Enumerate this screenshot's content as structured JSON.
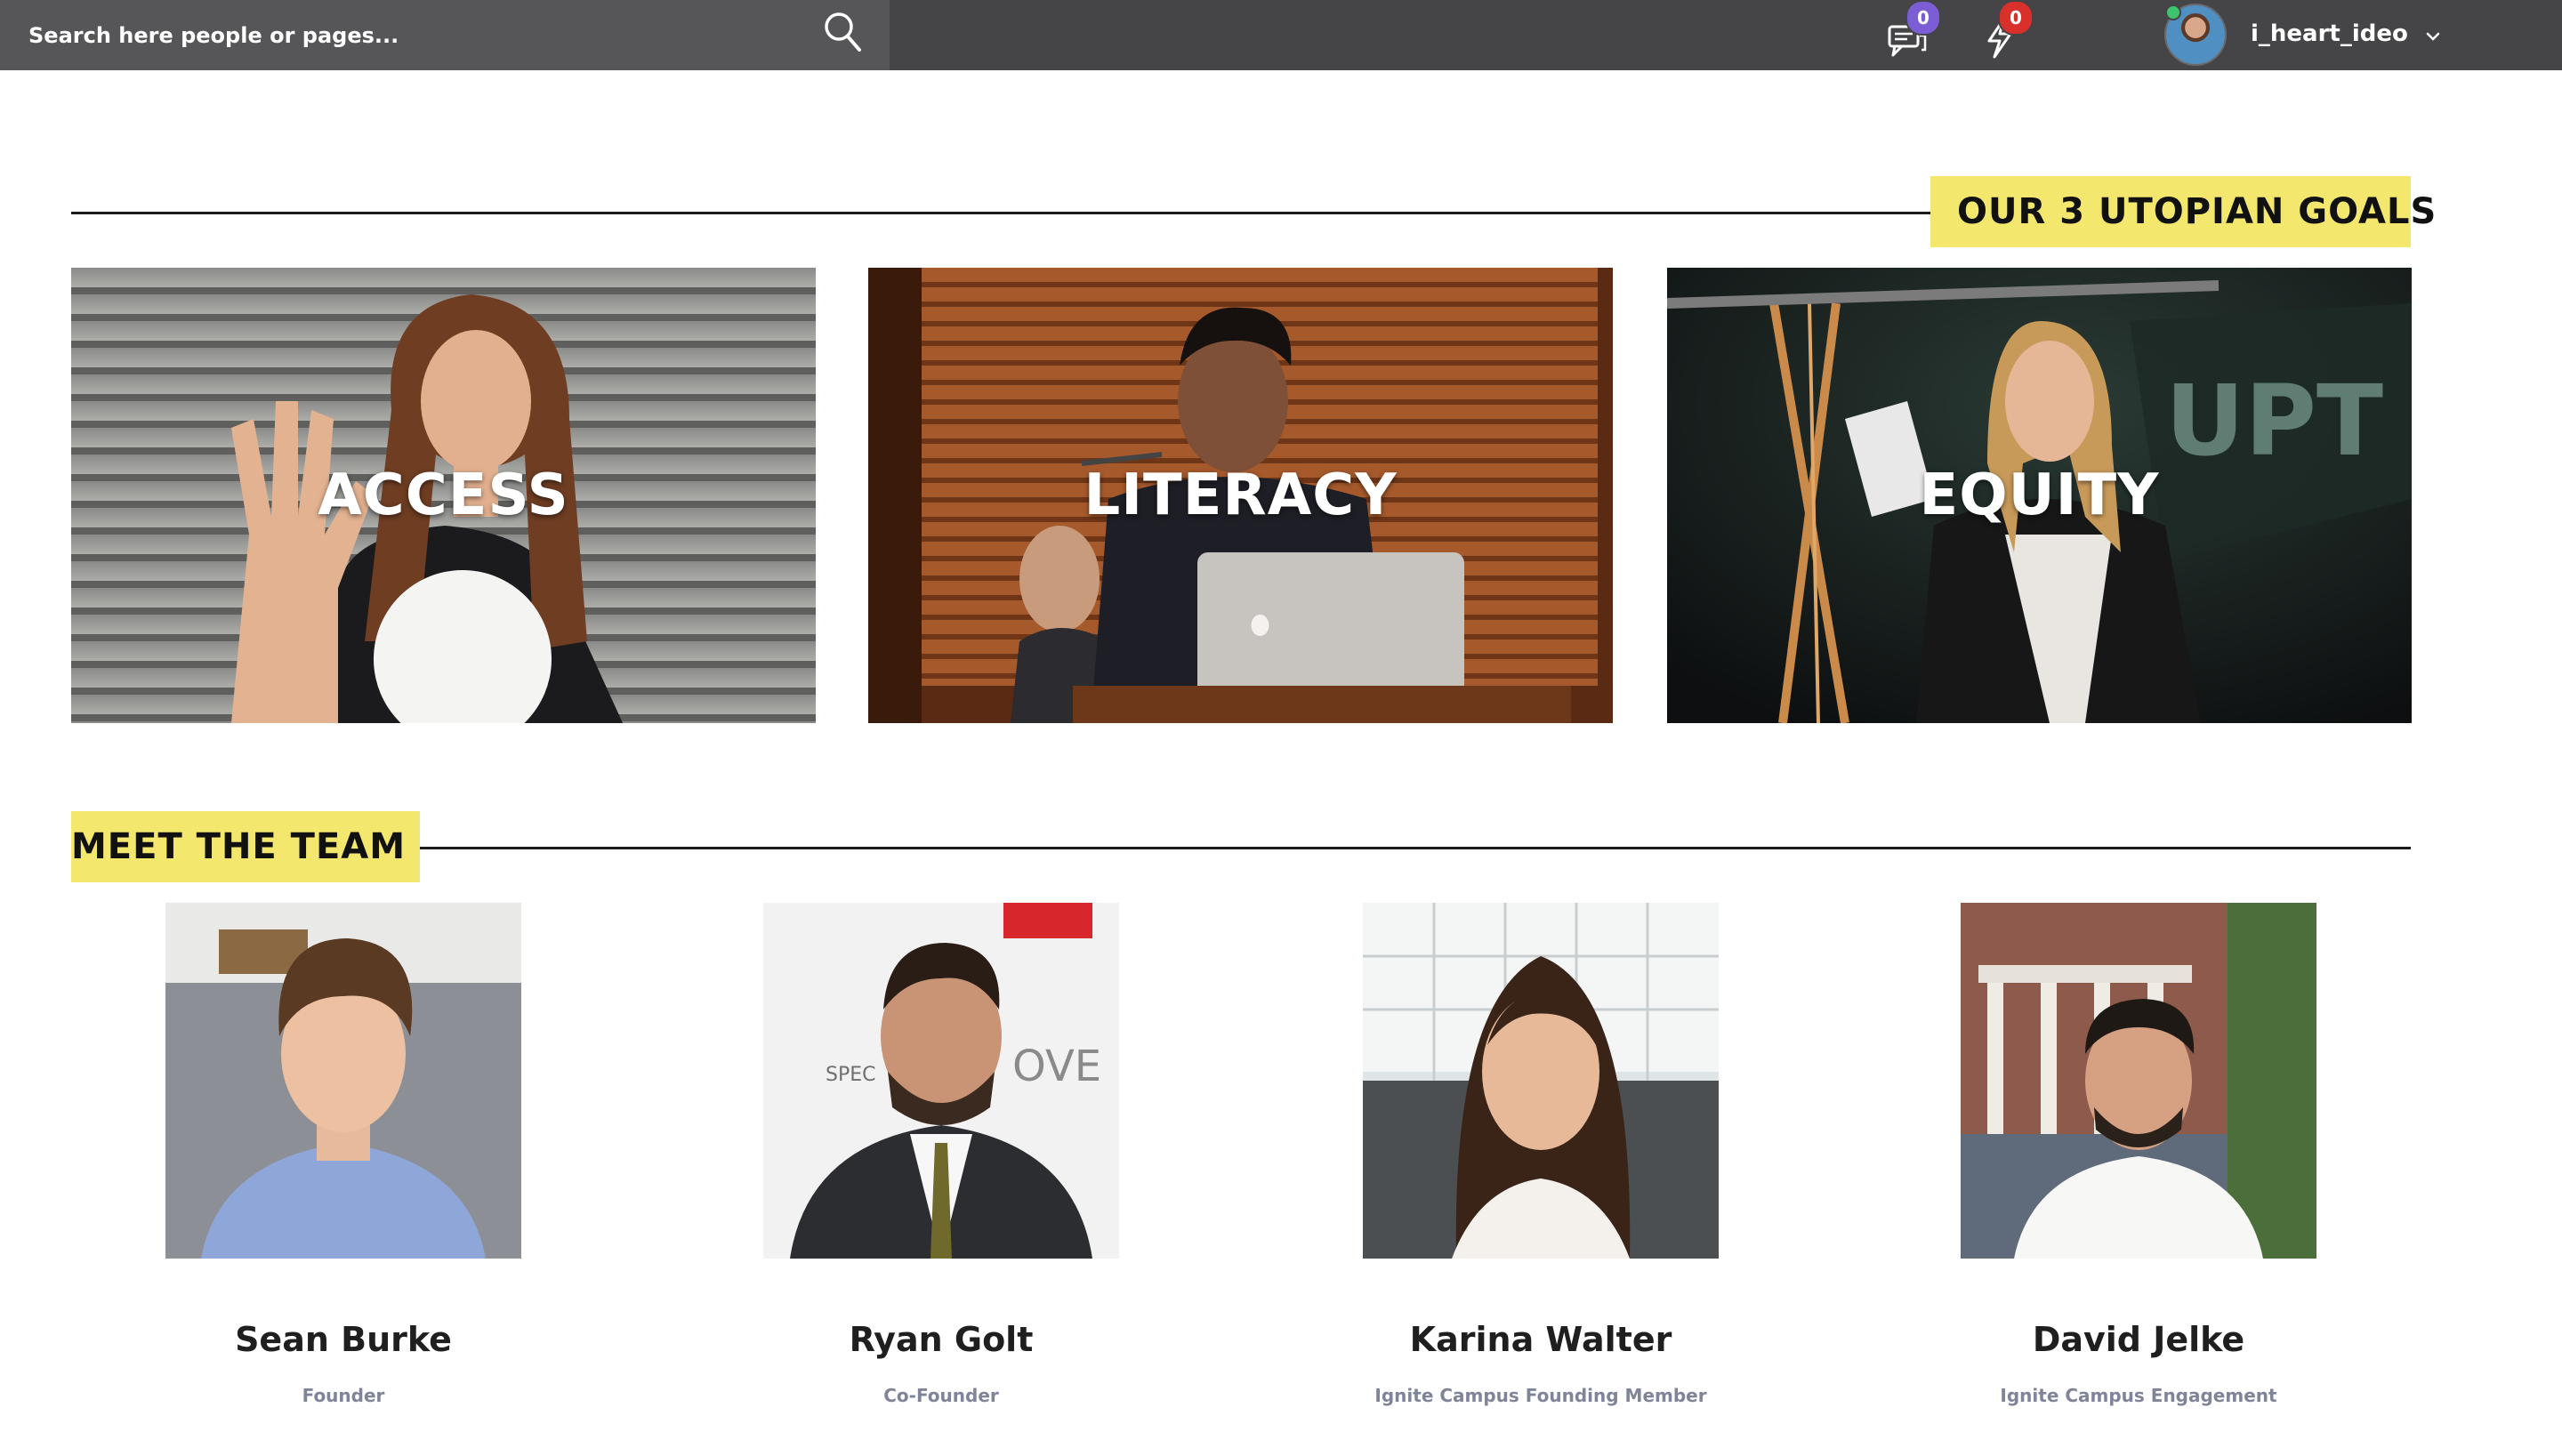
{
  "topbar": {
    "search_placeholder": "Search here people or pages...",
    "messages_count": "0",
    "notifications_count": "0",
    "username": "i_heart_ideo",
    "icons": {
      "search": "search-icon",
      "messages": "chat-icon",
      "notifications": "lightning-icon",
      "user_menu": "chevron-down-icon"
    },
    "colors": {
      "bar": "#454547",
      "messages_badge": "#7b5ed6",
      "notifications_badge": "#d9302b"
    }
  },
  "goals": {
    "heading": "OUR 3 UTOPIAN GOALS",
    "cards": [
      {
        "title": "ACCESS"
      },
      {
        "title": "LITERACY"
      },
      {
        "title": "EQUITY"
      }
    ]
  },
  "team": {
    "heading": "MEET THE TEAM",
    "members": [
      {
        "name": "Sean Burke",
        "role": "Founder"
      },
      {
        "name": "Ryan Golt",
        "role": "Co-Founder"
      },
      {
        "name": "Karina Walter",
        "role": "Ignite Campus Founding Member"
      },
      {
        "name": "David Jelke",
        "role": "Ignite Campus Engagement"
      }
    ]
  },
  "theme": {
    "accent": "#f4e76e",
    "role_text": "#7f8498"
  }
}
